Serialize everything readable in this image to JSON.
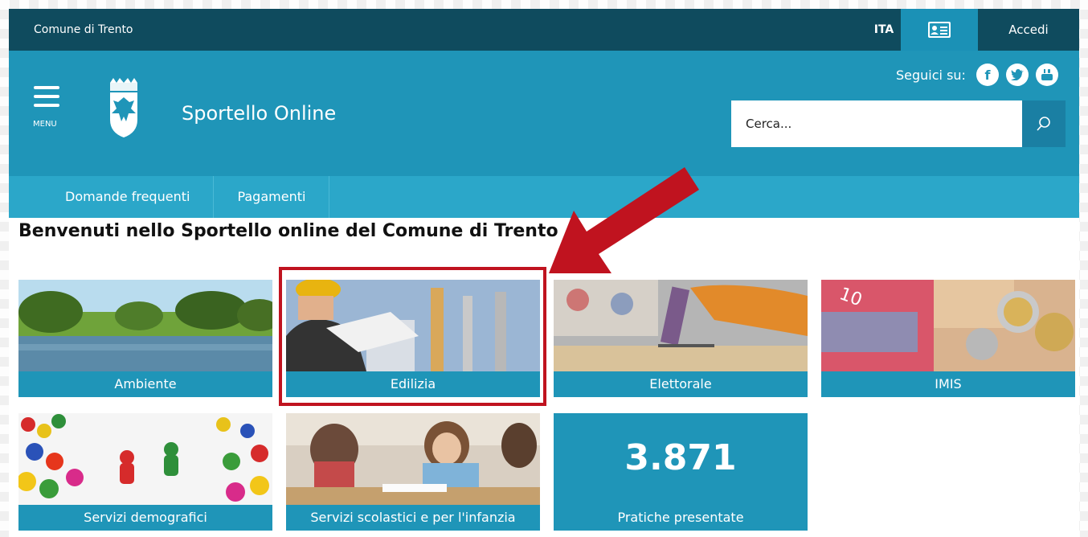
{
  "topbar": {
    "site_name": "Comune di Trento",
    "lang": "ITA",
    "login": "Accedi"
  },
  "header": {
    "menu_label": "MENU",
    "title": "Sportello Online",
    "follow_label": "Seguici su:",
    "search_placeholder": "Cerca..."
  },
  "nav": {
    "items": [
      {
        "label": "Domande frequenti"
      },
      {
        "label": "Pagamenti"
      }
    ]
  },
  "main": {
    "heading": "Benvenuti nello Sportello online del Comune di Trento",
    "tiles": [
      {
        "label": "Ambiente"
      },
      {
        "label": "Edilizia"
      },
      {
        "label": "Elettorale"
      },
      {
        "label": "IMIS"
      },
      {
        "label": "Servizi demografici"
      },
      {
        "label": "Servizi scolastici e per l'infanzia"
      }
    ],
    "stat": {
      "value": "3.871",
      "label": "Pratiche presentate"
    }
  },
  "colors": {
    "topbar": "#0f4b5e",
    "header": "#1f95b8",
    "nav": "#2ba7c9",
    "highlight": "#c0131f"
  },
  "icons": [
    "hamburger-icon",
    "coat-of-arms-logo",
    "id-card-icon",
    "facebook-icon",
    "twitter-icon",
    "youtube-icon",
    "search-icon",
    "red-arrow"
  ]
}
